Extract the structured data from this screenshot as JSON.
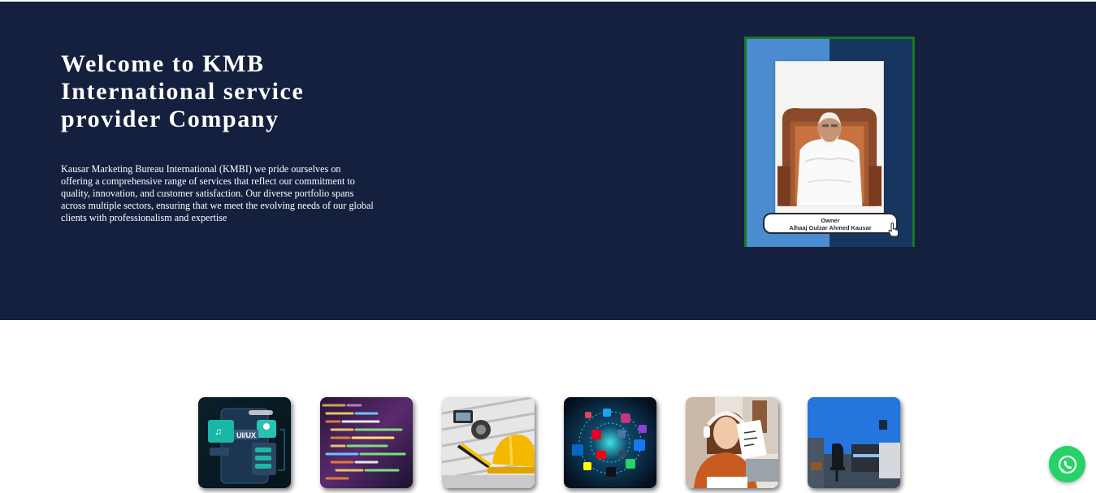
{
  "hero": {
    "title": "Welcome to KMB International service provider Company",
    "description": "Kausar Marketing Bureau International (KMBI) we pride ourselves on offering a comprehensive range of services that reflect our commitment to quality, innovation, and customer satisfaction. Our diverse portfolio spans across multiple sectors, ensuring that we meet the evolving needs of our global clients with professionalism and expertise",
    "owner": {
      "role": "Owner",
      "name": "Alhaaj Gulzar Ahmed Kausar"
    }
  },
  "services": {
    "tiles": [
      {
        "name": "ui-ux-design",
        "icon": "ui-ux-icon",
        "label": "UI/UX"
      },
      {
        "name": "software-development",
        "icon": "code-icon"
      },
      {
        "name": "construction",
        "icon": "hard-hat-icon"
      },
      {
        "name": "social-media-marketing",
        "icon": "social-network-icon"
      },
      {
        "name": "online-teaching",
        "icon": "student-icon"
      },
      {
        "name": "office-space",
        "icon": "office-icon"
      }
    ]
  },
  "whatsapp": {
    "icon": "whatsapp-icon"
  },
  "colors": {
    "hero_bg": "#15203e",
    "frame_border": "#157a22",
    "whatsapp": "#25d366"
  }
}
